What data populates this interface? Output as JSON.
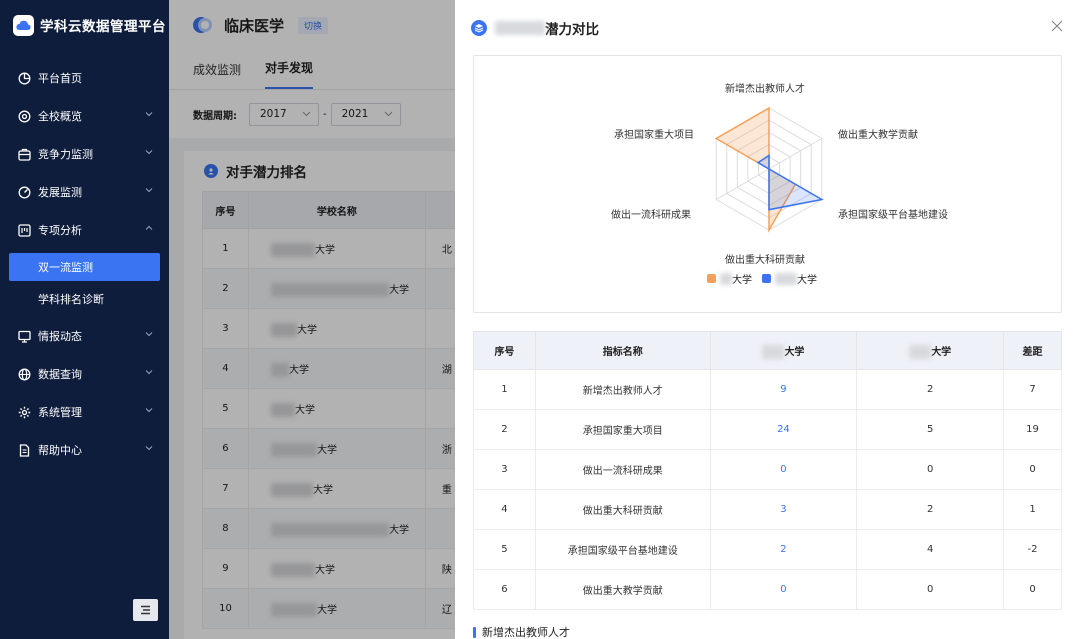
{
  "app": {
    "title": "学科云数据管理平台"
  },
  "sidebar": {
    "items": [
      {
        "label": "平台首页",
        "icon": "dashboard-icon",
        "has_children": false
      },
      {
        "label": "全校概览",
        "icon": "target-icon",
        "has_children": true
      },
      {
        "label": "竞争力监测",
        "icon": "briefcase-icon",
        "has_children": true
      },
      {
        "label": "发展监测",
        "icon": "gauge-icon",
        "has_children": true
      },
      {
        "label": "专项分析",
        "icon": "analysis-icon",
        "has_children": true,
        "expanded": true,
        "children": [
          {
            "label": "双一流监测",
            "active": true
          },
          {
            "label": "学科排名诊断",
            "active": false
          }
        ]
      },
      {
        "label": "情报动态",
        "icon": "monitor-icon",
        "has_children": true
      },
      {
        "label": "数据查询",
        "icon": "globe-icon",
        "has_children": true
      },
      {
        "label": "系统管理",
        "icon": "gear-icon",
        "has_children": true
      },
      {
        "label": "帮助中心",
        "icon": "document-icon",
        "has_children": true
      }
    ]
  },
  "header": {
    "title": "临床医学",
    "switch_label": "切换"
  },
  "tabs": [
    {
      "label": "成效监测",
      "active": false
    },
    {
      "label": "对手发现",
      "active": true
    }
  ],
  "filter": {
    "label": "数据周期:",
    "start_year": "2017",
    "separator": "-",
    "end_year": "2021"
  },
  "ranking_card": {
    "title": "对手潜力排名",
    "columns": [
      "序号",
      "学校名称"
    ],
    "rows": [
      {
        "no": "1",
        "suffix": "大学",
        "extra": "北"
      },
      {
        "no": "2",
        "suffix": "大学",
        "extra": ""
      },
      {
        "no": "3",
        "suffix": "大学",
        "extra": ""
      },
      {
        "no": "4",
        "suffix": "大学",
        "extra": "湖"
      },
      {
        "no": "5",
        "suffix": "大学",
        "extra": ""
      },
      {
        "no": "6",
        "suffix": "大学",
        "extra": "浙"
      },
      {
        "no": "7",
        "suffix": "大学",
        "extra": "重"
      },
      {
        "no": "8",
        "suffix": "大学",
        "extra": ""
      },
      {
        "no": "9",
        "suffix": "大学",
        "extra": "陕"
      },
      {
        "no": "10",
        "suffix": "大学",
        "extra": "辽"
      }
    ]
  },
  "drawer": {
    "title_suffix": "潜力对比",
    "radar": {
      "axes": [
        "新增杰出教师人才",
        "做出重大教学贡献",
        "承担国家级平台基地建设",
        "做出重大科研贡献",
        "做出一流科研成果",
        "承担国家重大项目"
      ],
      "legend": [
        {
          "label": "大学",
          "color": "#f5a05a"
        },
        {
          "label": "大学",
          "color": "#3a74f2"
        }
      ]
    },
    "table": {
      "headers": {
        "no": "序号",
        "metric": "指标名称",
        "school_a": "大学",
        "school_b": "大学",
        "gap": "差距"
      },
      "rows": [
        {
          "no": "1",
          "metric": "新增杰出教师人才",
          "a": "9",
          "b": "2",
          "gap": "7"
        },
        {
          "no": "2",
          "metric": "承担国家重大项目",
          "a": "24",
          "b": "5",
          "gap": "19"
        },
        {
          "no": "3",
          "metric": "做出一流科研成果",
          "a": "0",
          "b": "0",
          "gap": "0"
        },
        {
          "no": "4",
          "metric": "做出重大科研贡献",
          "a": "3",
          "b": "2",
          "gap": "1"
        },
        {
          "no": "5",
          "metric": "承担国家级平台基地建设",
          "a": "2",
          "b": "4",
          "gap": "-2"
        },
        {
          "no": "6",
          "metric": "做出重大教学贡献",
          "a": "0",
          "b": "0",
          "gap": "0"
        }
      ]
    },
    "section_title": "新增杰出教师人才"
  },
  "colors": {
    "accent": "#3a74f2",
    "sidebar_bg": "#0f1d3d",
    "series_a": "#f5a05a",
    "series_b": "#3a74f2"
  }
}
